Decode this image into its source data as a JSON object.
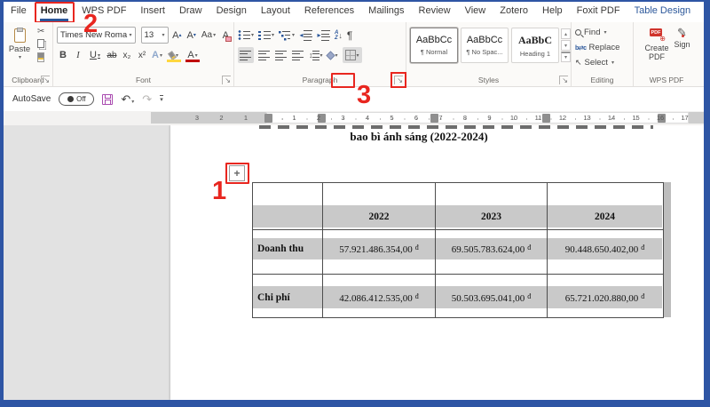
{
  "colors": {
    "accent_blue": "#2b579a",
    "window_border": "#2e55a4",
    "annotation_red": "#e8261f",
    "band_grey": "#c9c9c9",
    "pdf_red": "#d0342c",
    "save_purple": "#a94bb0"
  },
  "tab_bar": {
    "tabs": [
      {
        "label": "File"
      },
      {
        "label": "Home",
        "active": true
      },
      {
        "label": "WPS PDF"
      },
      {
        "label": "Insert"
      },
      {
        "label": "Draw"
      },
      {
        "label": "Design"
      },
      {
        "label": "Layout"
      },
      {
        "label": "References"
      },
      {
        "label": "Mailings"
      },
      {
        "label": "Review"
      },
      {
        "label": "View"
      },
      {
        "label": "Zotero"
      },
      {
        "label": "Help"
      },
      {
        "label": "Foxit PDF"
      },
      {
        "label": "Table Design",
        "accent": true
      }
    ]
  },
  "ribbon": {
    "clipboard": {
      "label": "Clipboard",
      "paste_label": "Paste"
    },
    "font": {
      "label": "Font",
      "font_name": "Times New Roma",
      "font_size": "13",
      "bold": "B",
      "italic": "I",
      "underline": "U",
      "strikethrough": "ab",
      "subscript": "x₂",
      "superscript": "x²",
      "grow": "A",
      "shrink": "A",
      "change_case": "Aa",
      "clear": "A",
      "effects": "A",
      "highlight_letters": "",
      "color_letter": "A"
    },
    "paragraph": {
      "label": "Paragraph",
      "sort_a": "A",
      "sort_z": "Z",
      "sort_arrow": "↓",
      "pilcrow": "¶"
    },
    "styles": {
      "label": "Styles",
      "gallery": [
        {
          "preview": "AaBbCc",
          "name": "¶ Normal",
          "selected": true,
          "serif": false
        },
        {
          "preview": "AaBbCc",
          "name": "¶ No Spac...",
          "selected": false,
          "serif": false
        },
        {
          "preview": "AaBbC",
          "name": "Heading 1",
          "selected": false,
          "serif": true
        }
      ]
    },
    "editing": {
      "label": "Editing",
      "find": "Find",
      "replace": "Replace",
      "select": "Select",
      "replace_glyph": "b⇄c"
    },
    "wps": {
      "label": "WPS PDF",
      "create_pdf_line1": "Create",
      "create_pdf_line2": "PDF",
      "sign": "Sign",
      "pdf_badge": "PDF"
    }
  },
  "qat": {
    "autosave": "AutoSave",
    "autosave_state": "Off"
  },
  "ruler": {
    "margin_labels": [
      "3",
      "2",
      "1"
    ],
    "labels": [
      "1",
      "2",
      "3",
      "4",
      "5",
      "6",
      "7",
      "8",
      "9",
      "10",
      "11",
      "12",
      "13",
      "14",
      "15",
      "16",
      "17"
    ]
  },
  "annotations": {
    "step1": "1",
    "step2": "2",
    "step3": "3"
  },
  "document": {
    "title": "bao bì ánh sáng (2022-2024)",
    "table": {
      "header_years": [
        "2022",
        "2023",
        "2024"
      ],
      "rows": [
        {
          "label": "Doanh thu",
          "values": [
            {
              "amount": "57.921.486.354,00",
              "currency": "đ"
            },
            {
              "amount": "69.505.783.624,00",
              "currency": "đ"
            },
            {
              "amount": "90.448.650.402,00",
              "currency": "đ"
            }
          ]
        },
        {
          "label": "Chi phí",
          "values": [
            {
              "amount": "42.086.412.535,00",
              "currency": "đ"
            },
            {
              "amount": "50.503.695.041,00",
              "currency": "đ"
            },
            {
              "amount": "65.721.020.880,00",
              "currency": "đ"
            }
          ]
        }
      ]
    }
  }
}
